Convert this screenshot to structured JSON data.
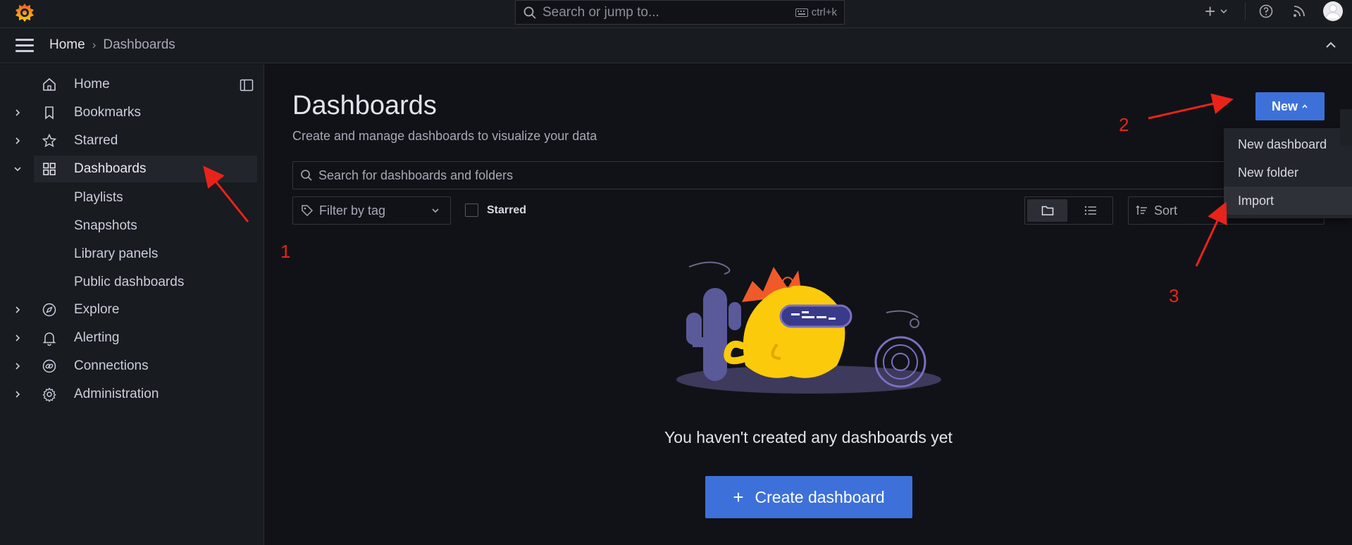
{
  "topbar": {
    "search_placeholder": "Search or jump to...",
    "search_shortcut": "ctrl+k",
    "add_label": "+"
  },
  "breadcrumb": {
    "home": "Home",
    "separator": "›",
    "current": "Dashboards"
  },
  "sidebar": {
    "items": [
      {
        "label": "Home",
        "icon": "home-icon"
      },
      {
        "label": "Bookmarks",
        "icon": "bookmark-icon"
      },
      {
        "label": "Starred",
        "icon": "star-icon"
      },
      {
        "label": "Dashboards",
        "icon": "apps-icon",
        "active": true
      },
      {
        "label": "Explore",
        "icon": "compass-icon"
      },
      {
        "label": "Alerting",
        "icon": "bell-icon"
      },
      {
        "label": "Connections",
        "icon": "link-icon"
      },
      {
        "label": "Administration",
        "icon": "cog-icon"
      }
    ],
    "sub_items": [
      "Playlists",
      "Snapshots",
      "Library panels",
      "Public dashboards"
    ]
  },
  "main": {
    "title": "Dashboards",
    "subtitle": "Create and manage dashboards to visualize your data",
    "new_button": "New",
    "search_placeholder": "Search for dashboards and folders",
    "filter_placeholder": "Filter by tag",
    "starred_label": "Starred",
    "sort_placeholder": "Sort",
    "empty_text": "You haven't created any dashboards yet",
    "create_button": "Create dashboard"
  },
  "new_menu": {
    "items": [
      "New dashboard",
      "New folder",
      "Import"
    ],
    "highlighted": "Import"
  },
  "annotations": {
    "labels": [
      "1",
      "2",
      "3"
    ],
    "color": "#e8241a"
  },
  "colors": {
    "accent": "#3d71d9",
    "active_marker": "#f55f3e",
    "background": "#111217",
    "panel": "#181b1f"
  }
}
